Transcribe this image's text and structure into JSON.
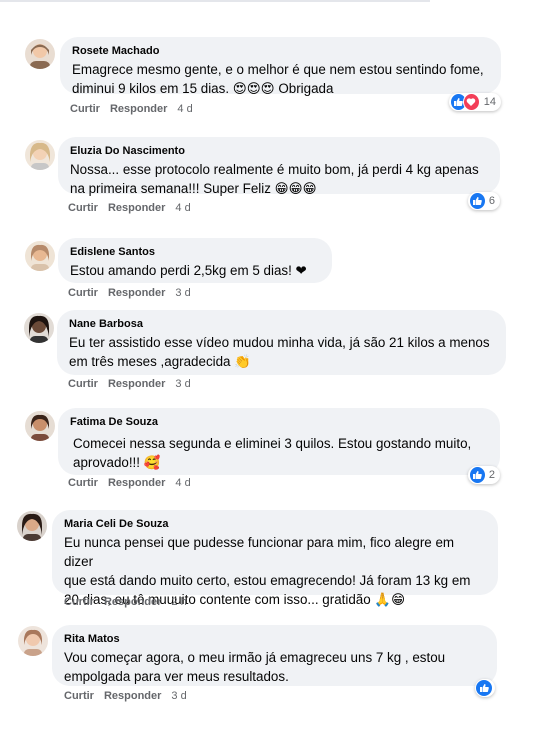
{
  "actions": {
    "like": "Curtir",
    "reply": "Responder"
  },
  "comments": [
    {
      "author": "Rosete  Machado",
      "text": "Emagrece mesmo gente, e o melhor é que nem estou sentindo fome,\ndiminui 9 kilos em 15 dias. 😍😍😍 Obrigada",
      "time": "4 d",
      "reactions": "14",
      "avatar_color": "#8a6a52"
    },
    {
      "author": "Eluzia  Do Nascimento",
      "text": "Nossa... esse protocolo realmente é muito bom, já perdi 4 kg apenas\nna primeira semana!!! Super Feliz 😁😁😁",
      "time": "4 d",
      "reactions": "6",
      "avatar_color": "#d7b98a"
    },
    {
      "author": "Edislene Santos",
      "text": "Estou amando perdi 2,5kg em 5 dias! ❤",
      "time": "3 d",
      "reactions": "",
      "avatar_color": "#b68a6a"
    },
    {
      "author": "Nane  Barbosa",
      "text": "Eu ter assistido esse vídeo mudou minha vida, já são 21 kilos a menos\nem três meses ,agradecida 👏",
      "time": "3 d",
      "reactions": "",
      "avatar_color": "#3a2a22"
    },
    {
      "author": "Fatima De Souza",
      "text": "Comecei nessa segunda e eliminei 3 quilos. Estou gostando muito,\naprovado!!! 🥰",
      "time": "4 d",
      "reactions": "2",
      "avatar_color": "#5a3a2a"
    },
    {
      "author": "Maria Celi De Souza",
      "text": "Eu nunca pensei que pudesse funcionar para mim, fico alegre em dizer\nque está dando muito certo, estou emagrecendo! Já foram 13 kg em\n20 dias, eu tô muuuito contente com isso... gratidão 🙏😁",
      "time": "2 h",
      "reactions": "",
      "avatar_color": "#3b2b25"
    },
    {
      "author": "Rita Matos",
      "text": "Vou começar agora, o meu irmão já emagreceu uns 7 kg , estou\nempolgada para ver meus resultados.",
      "time": "3 d",
      "reactions": "",
      "avatar_color": "#c9a28a"
    }
  ]
}
